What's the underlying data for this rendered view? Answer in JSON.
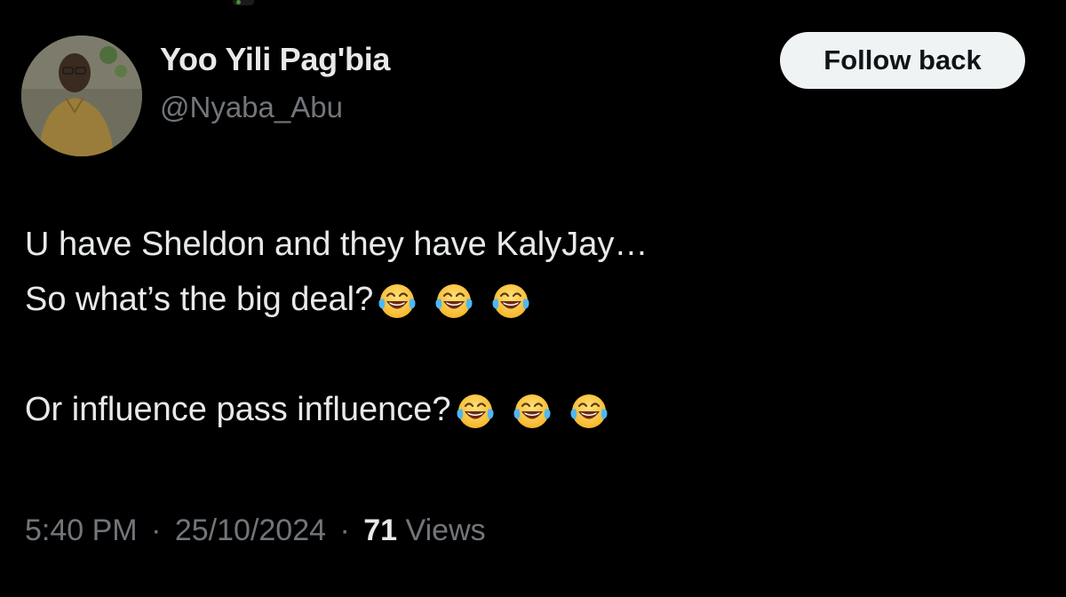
{
  "author": {
    "display_name": "Yoo Yili Pag'bia",
    "handle": "@Nyaba_Abu",
    "avatar_icon": "profile-photo"
  },
  "follow_button": {
    "label": "Follow back"
  },
  "tweet": {
    "line1": "U have Sheldon and they have KalyJay…",
    "line2": "So what’s the big deal?",
    "line2_emojis": [
      "face-with-tears-of-joy",
      "face-with-tears-of-joy",
      "face-with-tears-of-joy"
    ],
    "line3": "Or influence pass influence?",
    "line3_emojis": [
      "face-with-tears-of-joy",
      "face-with-tears-of-joy",
      "face-with-tears-of-joy"
    ]
  },
  "meta": {
    "time": "5:40 PM",
    "separator": "·",
    "date": "25/10/2024",
    "views_count": "71",
    "views_label": "Views"
  },
  "colors": {
    "background": "#000000",
    "primary_text": "#e7e9ea",
    "secondary_text": "#71767b",
    "button_bg": "#eff3f4",
    "button_text": "#0f1419"
  }
}
